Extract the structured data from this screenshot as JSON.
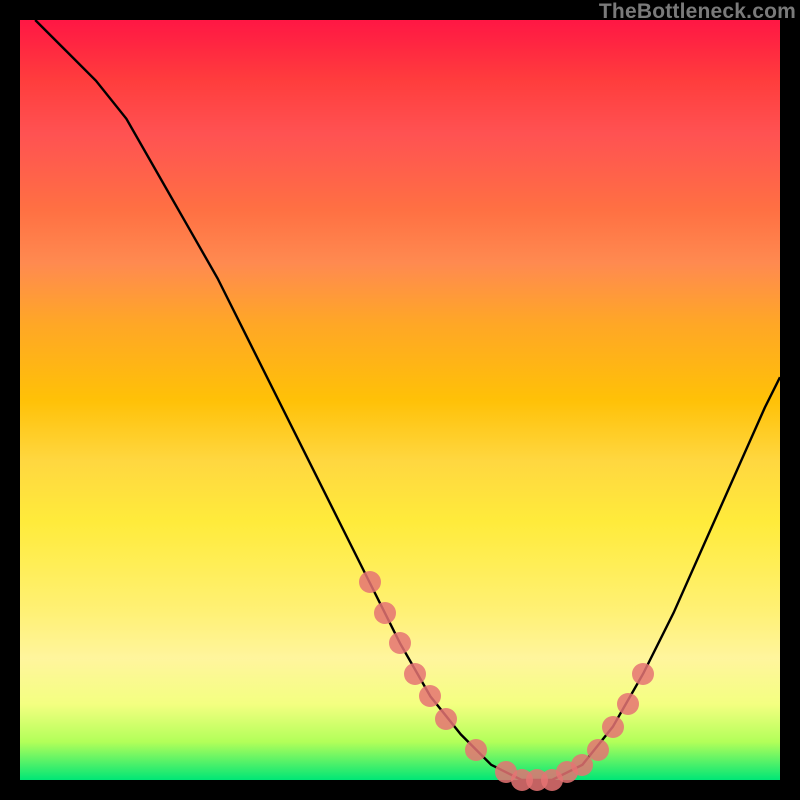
{
  "watermark": "TheBottleneck.com",
  "chart_data": {
    "type": "line",
    "title": "",
    "xlabel": "",
    "ylabel": "",
    "xlim": [
      0,
      100
    ],
    "ylim": [
      0,
      100
    ],
    "grid": false,
    "legend": false,
    "background_gradient": {
      "top": "#ff1744",
      "mid": "#ffeb3b",
      "bottom": "#00e676"
    },
    "series": [
      {
        "name": "curve",
        "x": [
          2,
          6,
          10,
          14,
          18,
          22,
          26,
          30,
          34,
          38,
          42,
          46,
          50,
          54,
          58,
          62,
          66,
          70,
          74,
          78,
          82,
          86,
          90,
          94,
          98,
          100
        ],
        "y": [
          100,
          96,
          92,
          87,
          80,
          73,
          66,
          58,
          50,
          42,
          34,
          26,
          18,
          11,
          6,
          2,
          0,
          0,
          2,
          7,
          14,
          22,
          31,
          40,
          49,
          53
        ]
      }
    ],
    "markers": {
      "name": "highlight-dots",
      "color": "#e57373",
      "x": [
        46,
        48,
        50,
        52,
        54,
        56,
        60,
        64,
        66,
        68,
        70,
        72,
        74,
        76,
        78,
        80,
        82
      ],
      "y": [
        26,
        22,
        18,
        14,
        11,
        8,
        4,
        1,
        0,
        0,
        0,
        1,
        2,
        4,
        7,
        10,
        14
      ]
    }
  }
}
